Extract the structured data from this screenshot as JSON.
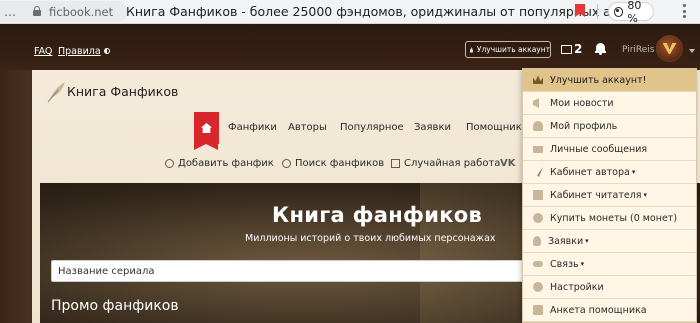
{
  "browser": {
    "more_glyph": "…",
    "url": "ficbook.net",
    "tab_title": "Книга Фанфиков - более 25000 фэндомов, ориджиналы от популярных автор...",
    "zoom": "80 %"
  },
  "header": {
    "faq": "FAQ",
    "rules": "Правила",
    "upgrade": "Улучшить аккаунт",
    "messages_count": "2",
    "username": "PiriReis"
  },
  "site": {
    "logo_text": "Книга Фанфиков",
    "nav": [
      "Фанфики",
      "Авторы",
      "Популярное",
      "Заявки",
      "Помощники"
    ],
    "subnav": {
      "add": "Добавить фанфик",
      "search": "Поиск фанфиков",
      "random": "Случайная работа",
      "vk": "VK"
    }
  },
  "hero": {
    "title": "Книга фанфиков",
    "subtitle": "Миллионы историй о твоих любимых персонажах",
    "search_placeholder": "Название сериала",
    "promo_title": "Промо фанфиков"
  },
  "dropdown": {
    "items": [
      {
        "label": "Улучшить аккаунт!",
        "icon": "crown-icon"
      },
      {
        "label": "Мои новости",
        "icon": "megaphone-icon"
      },
      {
        "label": "Мой профиль",
        "icon": "user-icon"
      },
      {
        "label": "Личные сообщения",
        "icon": "mail-icon"
      },
      {
        "label": "Кабинет автора",
        "icon": "quill-icon"
      },
      {
        "label": "Кабинет читателя",
        "icon": "book-icon"
      },
      {
        "label": "Купить монеты (0 монет)",
        "icon": "coins-icon"
      },
      {
        "label": "Заявки",
        "icon": "bulb-icon"
      },
      {
        "label": "Связь",
        "icon": "link-icon"
      },
      {
        "label": "Настройки",
        "icon": "gear-icon"
      },
      {
        "label": "Анкета помощника",
        "icon": "form-icon"
      }
    ]
  }
}
